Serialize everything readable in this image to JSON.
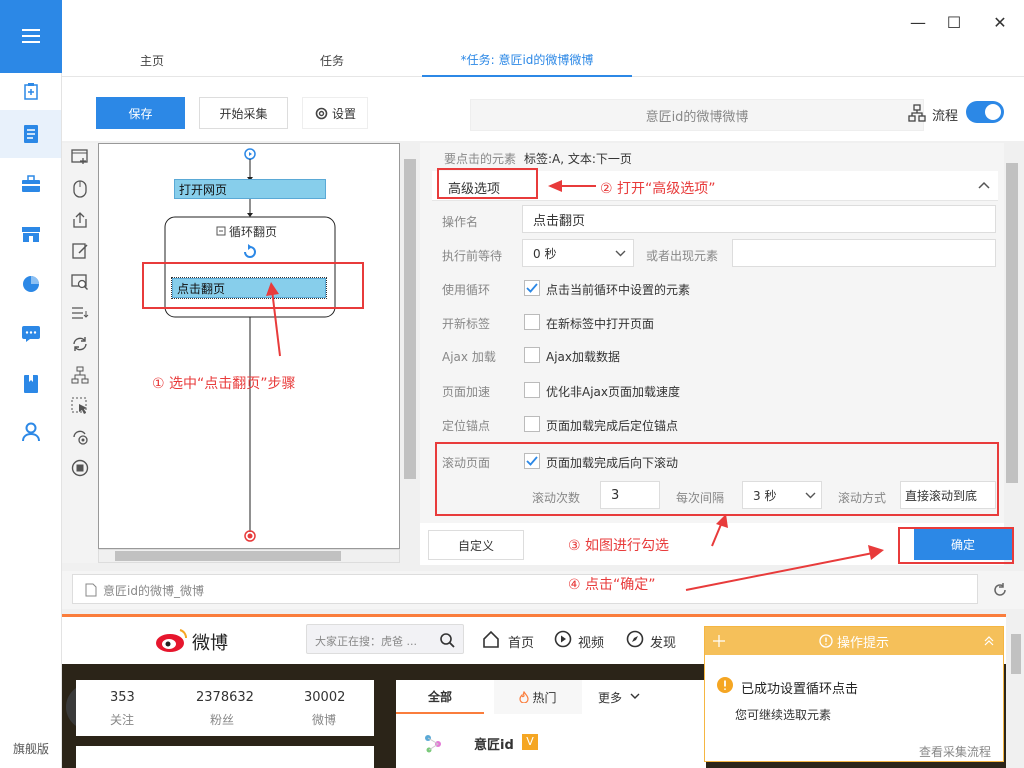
{
  "window": {
    "minimize": "—",
    "maximize": "☐",
    "close": "✕"
  },
  "tabs": [
    {
      "label": "主页"
    },
    {
      "label": "任务"
    },
    {
      "label": "*任务: 意匠id的微博微博"
    }
  ],
  "toolbar": {
    "save": "保存",
    "start": "开始采集",
    "settings": "设置",
    "task_name": "意匠id的微博微博",
    "flow": "流程"
  },
  "rail": {
    "flagship": "旗舰版"
  },
  "flow": {
    "open_page": "打开网页",
    "loop": "循环翻页",
    "click_next": "点击翻页"
  },
  "props": {
    "element_label": "要点击的元素",
    "element_value": "标签:A, 文本:下一页",
    "section": "高级选项",
    "op_name_label": "操作名",
    "op_name_value": "点击翻页",
    "wait_label": "执行前等待",
    "wait_value": "0 秒",
    "or_appear": "或者出现元素",
    "use_loop_label": "使用循环",
    "use_loop_text": "点击当前循环中设置的元素",
    "new_tab_label": "开新标签",
    "new_tab_text": "在新标签中打开页面",
    "ajax_label": "Ajax 加载",
    "ajax_text": "Ajax加载数据",
    "accel_label": "页面加速",
    "accel_text": "优化非Ajax页面加载速度",
    "anchor_label": "定位锚点",
    "anchor_text": "页面加载完成后定位锚点",
    "scroll_label": "滚动页面",
    "scroll_text": "页面加载完成后向下滚动",
    "scroll_count_label": "滚动次数",
    "scroll_count": "3",
    "interval_label": "每次间隔",
    "interval": "3 秒",
    "scroll_mode_label": "滚动方式",
    "scroll_mode": "直接滚动到底"
  },
  "footer": {
    "custom": "自定义",
    "ok": "确定"
  },
  "annotations": {
    "a1": "① 选中“点击翻页”步骤",
    "a2": "② 打开“高级选项”",
    "a3": "③ 如图进行勾选",
    "a4": "④ 点击“确定”"
  },
  "browser": {
    "url": "意匠id的微博_微博",
    "logo": "微博",
    "search": "大家正在搜：虎爸 ...",
    "nav": [
      "首页",
      "视频",
      "发现"
    ],
    "stats": [
      {
        "n": "353",
        "l": "关注"
      },
      {
        "n": "2378632",
        "l": "粉丝"
      },
      {
        "n": "30002",
        "l": "微博"
      }
    ],
    "feedtabs": [
      "全部",
      "热门",
      "更多"
    ],
    "username": "意匠id",
    "v_badge": "V"
  },
  "tips": {
    "title": "操作提示",
    "msg": "已成功设置循环点击",
    "sub": "您可继续选取元素",
    "link": "查看采集流程"
  },
  "colors": {
    "accent": "#2c88e6",
    "annotation": "#e83b3b",
    "tips": "#f5b642"
  }
}
